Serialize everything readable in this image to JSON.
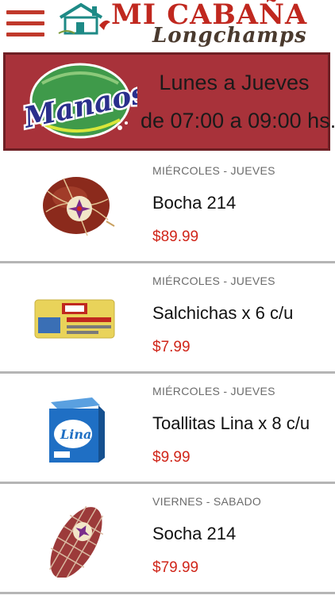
{
  "header": {
    "logo_title": "MI CABAÑA",
    "logo_subtitle": "Longchamps",
    "menu_icon": "hamburger-icon",
    "brand_color": "#c0281f"
  },
  "banner": {
    "brand": "Manaos",
    "line1": "Lunes a Jueves",
    "line2": "de 07:00 a 09:00 hs.",
    "background_color": "#a8323a"
  },
  "products": [
    {
      "days": "MIÉRCOLES - JUEVES",
      "name": "Bocha 214",
      "price": "$89.99",
      "image": "bocha-product-image"
    },
    {
      "days": "MIÉRCOLES - JUEVES",
      "name": "Salchichas x 6 c/u",
      "price": "$7.99",
      "image": "salchichas-product-image"
    },
    {
      "days": "MIÉRCOLES - JUEVES",
      "name": "Toallitas Lina x 8 c/u",
      "price": "$9.99",
      "image": "toallitas-product-image"
    },
    {
      "days": "VIERNES - SABADO",
      "name": "Socha 214",
      "price": "$79.99",
      "image": "socha-product-image"
    }
  ],
  "colors": {
    "price": "#d0261a",
    "divider": "#b5b5b5"
  }
}
